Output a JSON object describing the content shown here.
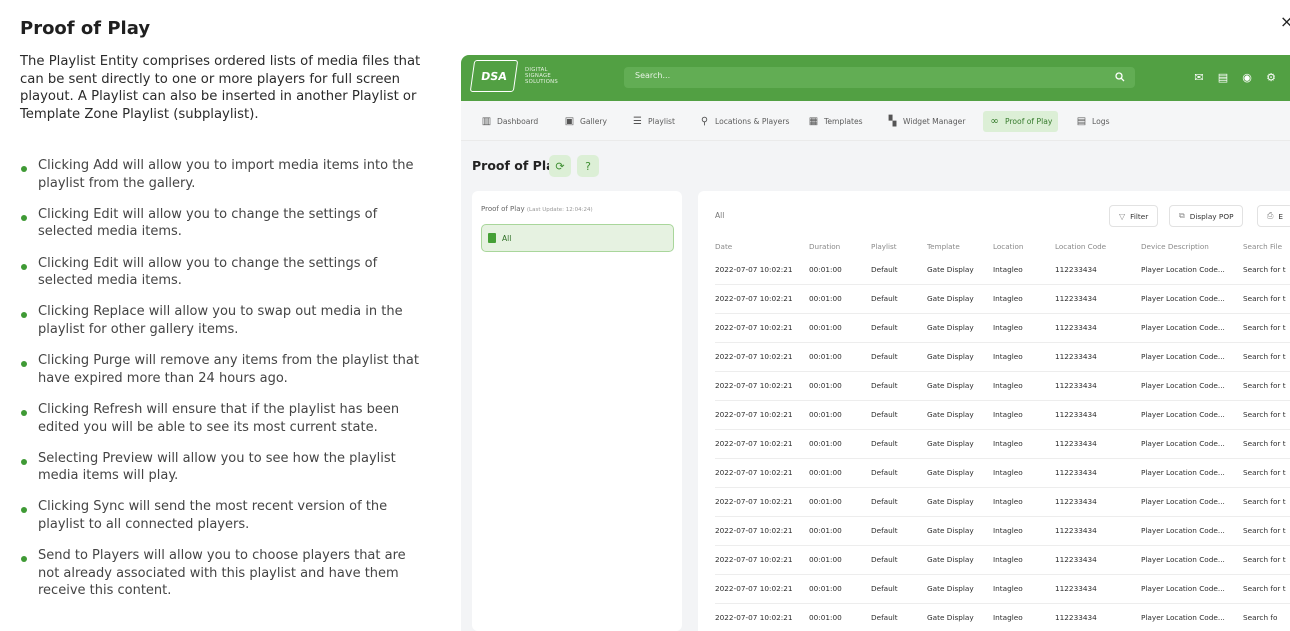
{
  "help": {
    "title": "Proof of Play",
    "close_glyph": "×",
    "intro": "The Playlist Entity comprises ordered lists of media files that can be sent directly to one or more players for full screen playout. A Playlist can also be inserted in another Playlist or Template Zone Playlist (subplaylist).",
    "bullets": [
      "Clicking Add will allow you to import media items into the playlist from the gallery.",
      "Clicking Edit will allow you to change the settings of selected media items.",
      "Clicking Edit will allow you to change the settings of selected media items.",
      "Clicking Replace will allow you to swap out media in the playlist for other gallery items.",
      "Clicking Purge will remove any items from the playlist that have expired more than 24 hours ago.",
      "Clicking Refresh will ensure that if the playlist has been edited you will be able to see its most current state.",
      "Selecting Preview will allow you to see how the playlist media items will play.",
      "Clicking Sync will send the most recent version of the playlist to all connected players.",
      "Send to Players will allow you to choose players that are not already associated with this playlist and have them receive this content."
    ],
    "bullet_color": "#3f9a35"
  },
  "app": {
    "brand_color": "#52a043",
    "logo": {
      "mark": "DSA",
      "sub": "DIGITAL SIGNAGE SOLUTIONS"
    },
    "search": {
      "placeholder": "Search..."
    },
    "top_icons": [
      "mail-icon",
      "document-icon",
      "globe-icon",
      "gear-icon"
    ],
    "nav": [
      {
        "label": "Dashboard",
        "icon": "dashboard-icon"
      },
      {
        "label": "Gallery",
        "icon": "gallery-icon"
      },
      {
        "label": "Playlist",
        "icon": "playlist-icon"
      },
      {
        "label": "Locations & Players",
        "icon": "location-pin-icon"
      },
      {
        "label": "Templates",
        "icon": "templates-icon"
      },
      {
        "label": "Widget Manager",
        "icon": "widget-icon"
      },
      {
        "label": "Proof of Play",
        "icon": "binoculars-icon",
        "active": true
      },
      {
        "label": "Logs",
        "icon": "logs-icon"
      }
    ],
    "page_title": "Proof of Play",
    "left_panel": {
      "title": "Proof of Play",
      "last_update": "(Last Update: 12:04:24)",
      "item": "All"
    },
    "right_panel": {
      "filter_label": "All",
      "buttons": {
        "filter": "Filter",
        "display_pop": "Display POP",
        "export": "E"
      },
      "columns": [
        "Date",
        "Duration",
        "Playlist",
        "Template",
        "Location",
        "Location Code",
        "Device Description",
        "Search File"
      ],
      "rows": [
        [
          "2022-07-07 10:02:21",
          "00:01:00",
          "Default",
          "Gate Display",
          "Intagleo",
          "112233434",
          "Player Location Code...",
          "Search for t"
        ],
        [
          "2022-07-07 10:02:21",
          "00:01:00",
          "Default",
          "Gate Display",
          "Intagleo",
          "112233434",
          "Player Location Code...",
          "Search for t"
        ],
        [
          "2022-07-07 10:02:21",
          "00:01:00",
          "Default",
          "Gate Display",
          "Intagleo",
          "112233434",
          "Player Location Code...",
          "Search for t"
        ],
        [
          "2022-07-07 10:02:21",
          "00:01:00",
          "Default",
          "Gate Display",
          "Intagleo",
          "112233434",
          "Player Location Code...",
          "Search for t"
        ],
        [
          "2022-07-07 10:02:21",
          "00:01:00",
          "Default",
          "Gate Display",
          "Intagleo",
          "112233434",
          "Player Location Code...",
          "Search for t"
        ],
        [
          "2022-07-07 10:02:21",
          "00:01:00",
          "Default",
          "Gate Display",
          "Intagleo",
          "112233434",
          "Player Location Code...",
          "Search for t"
        ],
        [
          "2022-07-07 10:02:21",
          "00:01:00",
          "Default",
          "Gate Display",
          "Intagleo",
          "112233434",
          "Player Location Code...",
          "Search for t"
        ],
        [
          "2022-07-07 10:02:21",
          "00:01:00",
          "Default",
          "Gate Display",
          "Intagleo",
          "112233434",
          "Player Location Code...",
          "Search for t"
        ],
        [
          "2022-07-07 10:02:21",
          "00:01:00",
          "Default",
          "Gate Display",
          "Intagleo",
          "112233434",
          "Player Location Code...",
          "Search for t"
        ],
        [
          "2022-07-07 10:02:21",
          "00:01:00",
          "Default",
          "Gate Display",
          "Intagleo",
          "112233434",
          "Player Location Code...",
          "Search for t"
        ],
        [
          "2022-07-07 10:02:21",
          "00:01:00",
          "Default",
          "Gate Display",
          "Intagleo",
          "112233434",
          "Player Location Code...",
          "Search for t"
        ],
        [
          "2022-07-07 10:02:21",
          "00:01:00",
          "Default",
          "Gate Display",
          "Intagleo",
          "112233434",
          "Player Location Code...",
          "Search for t"
        ],
        [
          "2022-07-07 10:02:21",
          "00:01:00",
          "Default",
          "Gate Display",
          "Intagleo",
          "112233434",
          "Player Location Code...",
          "Search fo"
        ]
      ]
    }
  }
}
